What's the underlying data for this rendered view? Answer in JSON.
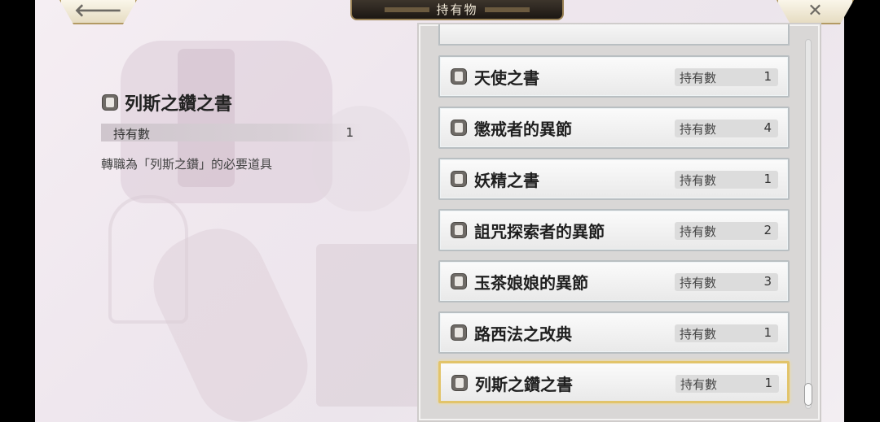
{
  "header": {
    "title": "持有物"
  },
  "back_icon": "left-arrow-icon",
  "close_icon": "close-icon",
  "detail": {
    "name": "列斯之鑽之書",
    "owned_label": "持有數",
    "owned_value": "1",
    "description": "轉職為「列斯之鑽」的必要道具"
  },
  "items": [
    {
      "name": "天使之書",
      "label": "持有數",
      "count": "1"
    },
    {
      "name": "懲戒者的異節",
      "label": "持有數",
      "count": "4"
    },
    {
      "name": "妖精之書",
      "label": "持有數",
      "count": "1"
    },
    {
      "name": "詛咒探索者的異節",
      "label": "持有數",
      "count": "2"
    },
    {
      "name": "玉茶娘娘的異節",
      "label": "持有數",
      "count": "3"
    },
    {
      "name": "路西法之改典",
      "label": "持有數",
      "count": "1"
    },
    {
      "name": "列斯之鑽之書",
      "label": "持有數",
      "count": "1"
    }
  ]
}
